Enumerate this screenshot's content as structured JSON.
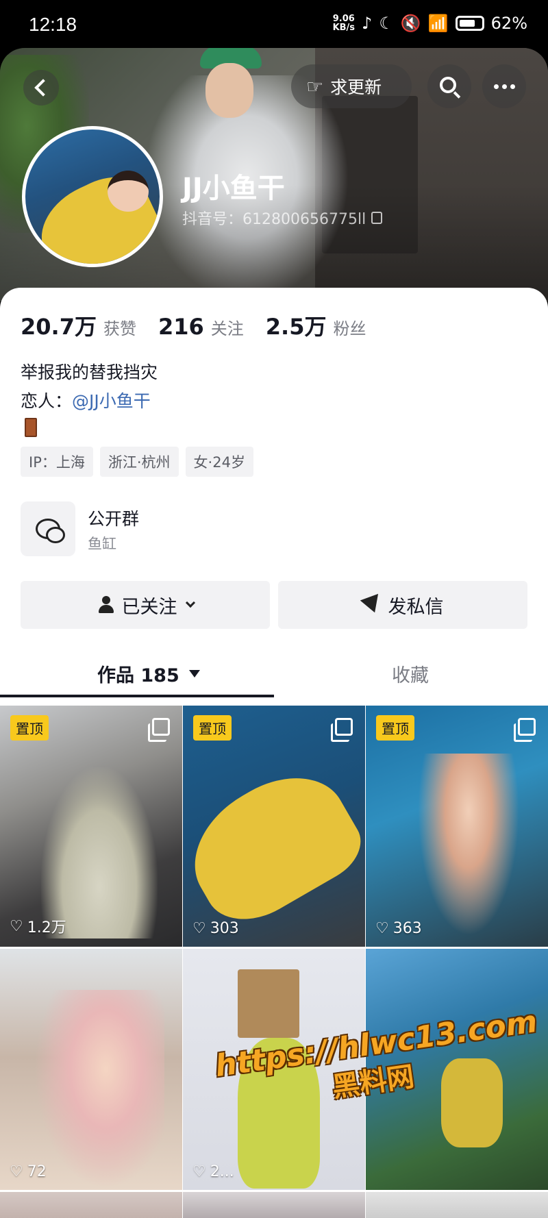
{
  "status_bar": {
    "time": "12:18",
    "net_speed_value": "9.06",
    "net_speed_unit": "KB/s",
    "battery": "62%"
  },
  "header": {
    "request_update_label": "求更新",
    "profile_name": "JJ小鱼干",
    "douyin_id": "抖音号：612800656775ll"
  },
  "stats": [
    {
      "value": "20.7万",
      "label": "获赞"
    },
    {
      "value": "216",
      "label": "关注"
    },
    {
      "value": "2.5万",
      "label": "粉丝"
    }
  ],
  "bio": {
    "line1": "举报我的替我挡灾",
    "line2_prefix": "恋人：",
    "line2_mention": "@JJ小鱼干"
  },
  "tags": [
    "IP：上海",
    "浙江·杭州",
    "女·24岁"
  ],
  "group": {
    "title": "公开群",
    "subtitle": "鱼缸"
  },
  "actions": {
    "follow_label": "已关注",
    "message_label": "发私信"
  },
  "tabs": {
    "works_label": "作品 185",
    "favorites_label": "收藏"
  },
  "grid": [
    {
      "pinned": "置顶",
      "likes": "1.2万"
    },
    {
      "pinned": "置顶",
      "likes": "303"
    },
    {
      "pinned": "置顶",
      "likes": "363"
    },
    {
      "pinned": "",
      "likes": "72"
    },
    {
      "pinned": "",
      "likes": "2..."
    },
    {
      "pinned": "",
      "likes": ""
    }
  ],
  "watermark": {
    "url": "https://hlwc13.com",
    "name": "黑料网"
  },
  "colors": {
    "accent_mention": "#3c6ab2",
    "pin_badge": "#f8c91d",
    "watermark": "#f6a623"
  }
}
